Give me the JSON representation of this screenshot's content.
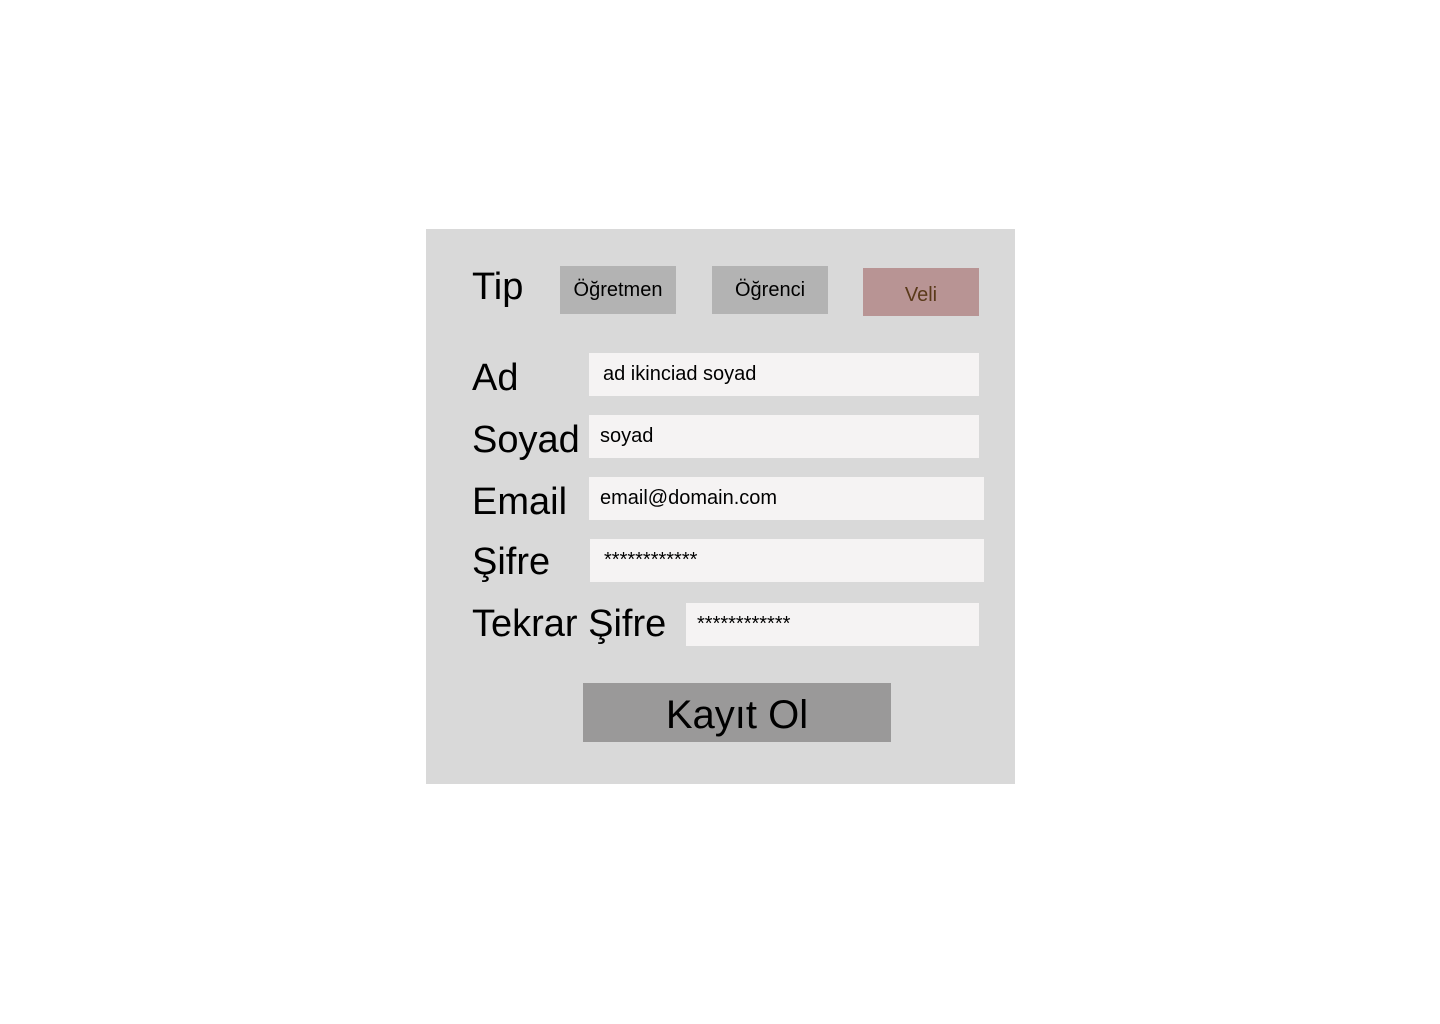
{
  "form": {
    "type_label": "Tip",
    "type_options": [
      {
        "label": "Öğretmen",
        "selected": false
      },
      {
        "label": "Öğrenci",
        "selected": false
      },
      {
        "label": "Veli",
        "selected": true
      }
    ],
    "fields": {
      "ad": {
        "label": "Ad",
        "value": "ad ikinciad soyad"
      },
      "soyad": {
        "label": "Soyad",
        "value": "soyad"
      },
      "email": {
        "label": "Email",
        "value": "email@domain.com"
      },
      "sifre": {
        "label": "Şifre",
        "value": "************"
      },
      "tekrar_sifre": {
        "label": "Tekrar Şifre",
        "value": "************"
      }
    },
    "submit_label": "Kayıt Ol"
  },
  "colors": {
    "panel": "#d9d9d9",
    "type_button": "#b3b3b3",
    "type_button_selected": "#b89494",
    "input_bg": "#f5f3f3",
    "submit_bg": "#9a9999"
  }
}
